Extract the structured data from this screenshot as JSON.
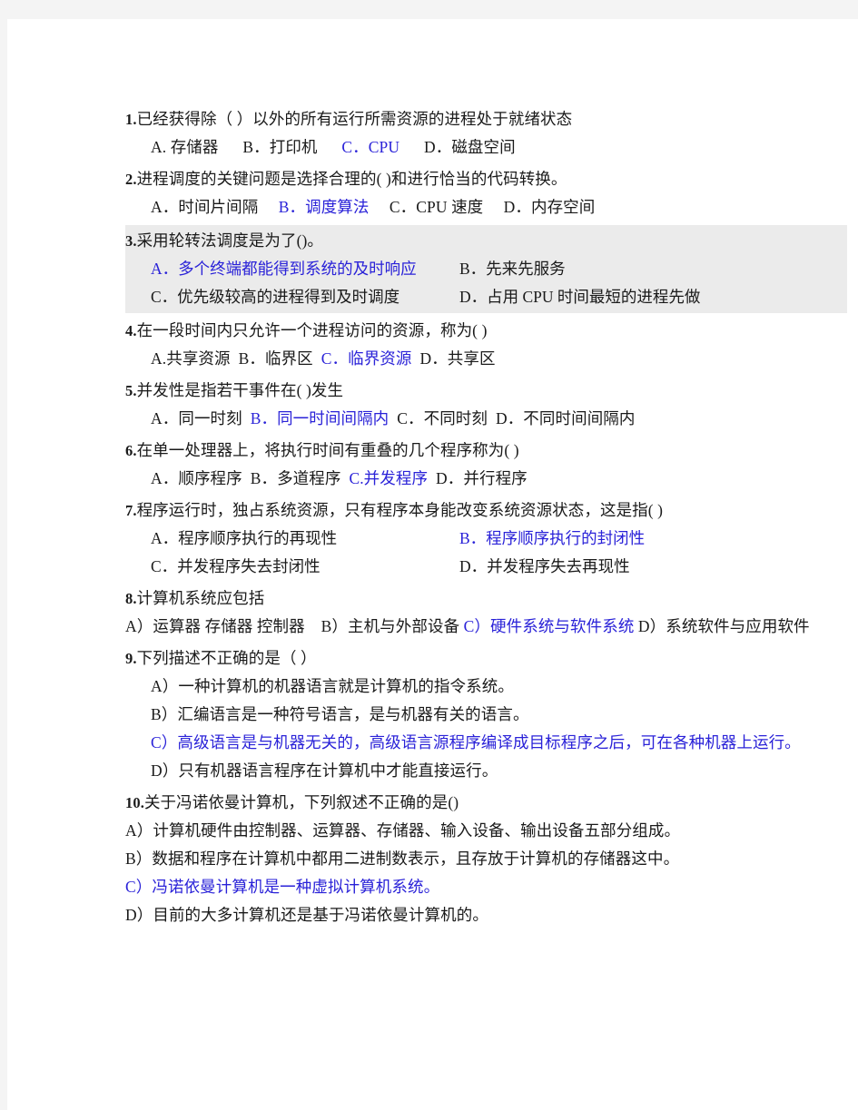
{
  "document": {
    "page_background": "#f4f4f4",
    "sheet_background": "#ffffff",
    "answer_color": "#2a22d8",
    "body_color": "#1a1a1a",
    "highlight_block_color": "#ebebeb"
  },
  "questions": [
    {
      "number": "1.",
      "stem": "已经获得除（   ）以外的所有运行所需资源的进程处于就绪状态",
      "layout": "single-line-options",
      "options_line": {
        "a": "A. 存储器",
        "b": "B．打印机",
        "c": "C．CPU",
        "d": "D．磁盘空间"
      },
      "answer": "C"
    },
    {
      "number": "2.",
      "stem": "进程调度的关键问题是选择合理的( )和进行恰当的代码转换。",
      "layout": "single-line-options",
      "options_line": {
        "a": "A．时间片间隔",
        "b": "B．调度算法",
        "c": "C．CPU 速度",
        "d": "D．内存空间"
      },
      "answer": "B"
    },
    {
      "number": "3.",
      "stem": "采用轮转法调度是为了()。",
      "layout": "two-column-options",
      "shaded": true,
      "options": {
        "a": "A．多个终端都能得到系统的及时响应",
        "b": "B．先来先服务",
        "c": "C．优先级较高的进程得到及时调度",
        "d": "D．占用 CPU 时间最短的进程先做"
      },
      "answer": "A"
    },
    {
      "number": "4.",
      "stem": "在一段时间内只允许一个进程访问的资源，称为( )",
      "layout": "single-line-options",
      "options_line": {
        "a": "A.共享资源",
        "b": "B．临界区",
        "c": "C．临界资源",
        "d": "D．共享区"
      },
      "answer": "C"
    },
    {
      "number": "5.",
      "stem": "并发性是指若干事件在( )发生",
      "layout": "single-line-options",
      "options_line": {
        "a": "A．同一时刻",
        "b": "B．同一时间间隔内",
        "c": "C．不同时刻",
        "d": "D．不同时间间隔内"
      },
      "answer": "B"
    },
    {
      "number": "6.",
      "stem": "在单一处理器上，将执行时间有重叠的几个程序称为( )",
      "layout": "single-line-options",
      "options_line": {
        "a": "A．顺序程序",
        "b": "B．多道程序",
        "c": "C.并发程序",
        "d": "D．并行程序"
      },
      "answer": "C"
    },
    {
      "number": "7.",
      "stem": "程序运行时，独占系统资源，只有程序本身能改变系统资源状态，这是指( )",
      "layout": "two-column-options",
      "options": {
        "a": "A．程序顺序执行的再现性",
        "b": "B．程序顺序执行的封闭性",
        "c": "C．并发程序失去封闭性",
        "d": "D．并发程序失去再现性"
      },
      "answer": "B"
    },
    {
      "number": "8.",
      "stem": "计算机系统应包括",
      "layout": "flow-options",
      "flow_options": {
        "a": "A）运算器 存储器 控制器",
        "b": "B）主机与外部设备",
        "c": "C）硬件系统与软件系统",
        "d": "D）系统软件与应用软件"
      },
      "answer": "C"
    },
    {
      "number": "9.",
      "stem": "下列描述不正确的是（    ）",
      "layout": "stacked-options",
      "stacked_options": [
        {
          "key": "A",
          "text": "A）一种计算机的机器语言就是计算机的指令系统。",
          "highlight": false
        },
        {
          "key": "B",
          "text": "B）汇编语言是一种符号语言，是与机器有关的语言。",
          "highlight": false
        },
        {
          "key": "C",
          "text": "C）高级语言是与机器无关的，高级语言源程序编译成目标程序之后，可在各种机器上运行。",
          "highlight": true
        },
        {
          "key": "D",
          "text": "D）只有机器语言程序在计算机中才能直接运行。",
          "highlight": false
        }
      ],
      "answer": "C"
    },
    {
      "number": "10.",
      "stem": "关于冯诺依曼计算机，下列叙述不正确的是()",
      "layout": "stacked-options-flush",
      "stacked_options": [
        {
          "key": "A",
          "text": "A）计算机硬件由控制器、运算器、存储器、输入设备、输出设备五部分组成。",
          "highlight": false
        },
        {
          "key": "B",
          "text": "B）数据和程序在计算机中都用二进制数表示，且存放于计算机的存储器这中。",
          "highlight": false
        },
        {
          "key": "C",
          "text": "C）冯诺依曼计算机是一种虚拟计算机系统。",
          "highlight": true
        },
        {
          "key": "D",
          "text": "D）目前的大多计算机还是基于冯诺依曼计算机的。",
          "highlight": false
        }
      ],
      "answer": "C"
    }
  ]
}
